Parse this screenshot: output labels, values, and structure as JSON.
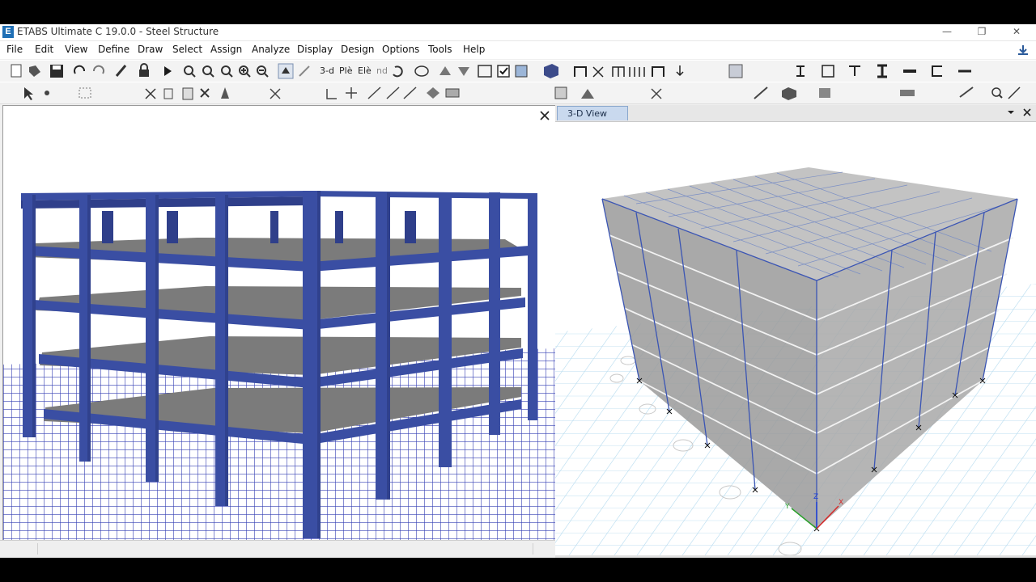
{
  "app": {
    "title": "ETABS Ultimate C 19.0.0 - Steel Structure",
    "logo_letter": "E",
    "accent": "#1f6fb5",
    "window_controls": [
      "minimize-icon",
      "restore-icon",
      "close-icon"
    ]
  },
  "menu": {
    "items": [
      "File",
      "Edit",
      "View",
      "Define",
      "Draw",
      "Select",
      "Assign",
      "Analyze",
      "Display",
      "Design",
      "Options",
      "Tools",
      "Help"
    ]
  },
  "toolbar": {
    "view_3d_label": "3-d",
    "plan_label": "Plè",
    "elev_label": "Elè",
    "nd_label": "nd"
  },
  "views": {
    "left_panel": {
      "close_icon": "close-icon",
      "frame_color": "#3a4ea3",
      "slab_color": "#7a7a7a",
      "grid_color": "#2a35b0"
    },
    "right_panel": {
      "tab_label": "3-D View",
      "grid_color": "#a9d5ec",
      "frame_color": "#3b55b4"
    }
  }
}
